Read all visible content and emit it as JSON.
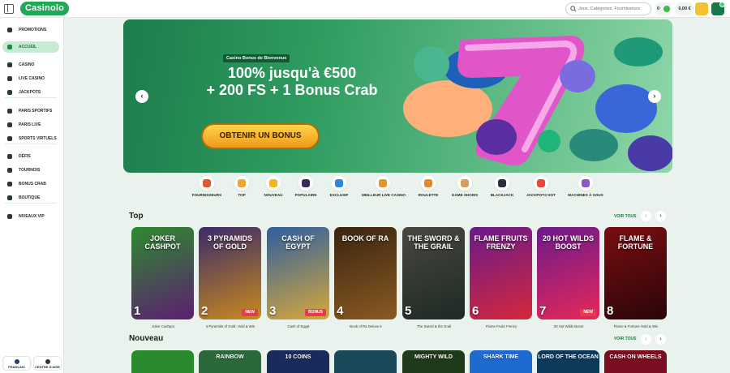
{
  "header": {
    "logo": "Casinolo",
    "search_placeholder": "Jeux, Catégories, Fournisseurs",
    "coins": "0",
    "balance": "0,00 €"
  },
  "sidebar": {
    "items": [
      {
        "label": "PROMOTIONS",
        "icon": "gift-icon"
      },
      {
        "label": "ACCUEIL",
        "icon": "home-icon",
        "active": true
      },
      {
        "label": "CASINO",
        "icon": "casino-chip-icon"
      },
      {
        "label": "LIVE CASINO",
        "icon": "live-casino-icon"
      },
      {
        "label": "JACKPOTS",
        "icon": "jackpot-icon"
      },
      {
        "label": "PARIS SPORTIFS",
        "icon": "football-icon"
      },
      {
        "label": "PARIS LIVE",
        "icon": "live-tv-icon"
      },
      {
        "label": "SPORTS VIRTUELS",
        "icon": "virtual-sports-icon"
      },
      {
        "label": "DÉFIS",
        "icon": "challenge-icon"
      },
      {
        "label": "TOURNOIS",
        "icon": "trophy-icon"
      },
      {
        "label": "BONUS CRAB",
        "icon": "crab-icon"
      },
      {
        "label": "BOUTIQUE",
        "icon": "shop-icon"
      },
      {
        "label": "NIVEAUX VIP",
        "icon": "vip-crown-icon"
      }
    ],
    "language": "FRANÇAIS",
    "help": "CENTRE D'AIDE"
  },
  "hero": {
    "tag": "Casino Bonus de Bienvenue",
    "line1": "100% jusqu'à €500",
    "line2": "+ 200 FS + 1 Bonus Crab",
    "cta": "OBTENIR UN BONUS",
    "prev": "‹",
    "next": "›",
    "slides": 3,
    "active_slide": 1
  },
  "categories": [
    {
      "label": "FOURNISSEURS",
      "color": "#e0592b"
    },
    {
      "label": "TOP",
      "color": "#f0a531"
    },
    {
      "label": "NOUVEAU",
      "color": "#f2b61f"
    },
    {
      "label": "POPULAIRE",
      "color": "#3a2b58"
    },
    {
      "label": "EXCLUSIF",
      "color": "#2f86e0"
    },
    {
      "label": "MEILLEUR LIVE CASINO",
      "color": "#e3962d"
    },
    {
      "label": "ROULETTE",
      "color": "#e58a29"
    },
    {
      "label": "GAME SHOWS",
      "color": "#d4a05a"
    },
    {
      "label": "BLACKJACK",
      "color": "#2b2f3a"
    },
    {
      "label": "JACKPOTS HOT",
      "color": "#e54a3a"
    },
    {
      "label": "MACHINES À SOUS",
      "color": "#8a59c8"
    }
  ],
  "top": {
    "title": "Top",
    "see_all": "VOIR TOUS",
    "prev": "‹",
    "next": "›",
    "games": [
      {
        "rank": "1",
        "art": "JOKER CASHPOT",
        "caption": "Joker Cashpot",
        "bg": "#2d8a2e",
        "bg2": "#5d1e72"
      },
      {
        "rank": "2",
        "art": "3 PYRAMIDS OF GOLD",
        "caption": "3 Pyramids of Gold: Hold & Win",
        "bg": "#3b2a6b",
        "bg2": "#c98a1c",
        "badge": "NEW"
      },
      {
        "rank": "3",
        "art": "CASH OF EGYPT",
        "caption": "Cash of Egypt",
        "bg": "#2d5ea0",
        "bg2": "#d6a83a",
        "badge": "BONUS"
      },
      {
        "rank": "4",
        "art": "BOOK OF RA",
        "caption": "Book of Ra Deluxe 6",
        "bg": "#3a2410",
        "bg2": "#8a5a22"
      },
      {
        "rank": "5",
        "art": "THE SWORD & THE GRAIL",
        "caption": "The Sword & the Grail",
        "bg": "#4a4640",
        "bg2": "#1d2a24"
      },
      {
        "rank": "6",
        "art": "FLAME FRUITS FRENZY",
        "caption": "Flame Fruits Frenzy",
        "bg": "#6a1a8a",
        "bg2": "#d4283c"
      },
      {
        "rank": "7",
        "art": "20 HOT WILDS BOOST",
        "caption": "20 Hot Wilds Boost",
        "bg": "#6a1a8a",
        "bg2": "#e6285a",
        "badge": "NEW"
      },
      {
        "rank": "8",
        "art": "FLAME & FORTUNE",
        "caption": "Flame & Fortune Hold & Win",
        "bg": "#7a0d12",
        "bg2": "#2a0608"
      }
    ]
  },
  "nouveau": {
    "title": "Nouveau",
    "see_all": "VOIR TOUS",
    "prev": "‹",
    "next": "›",
    "games": [
      {
        "art": "",
        "bg": "#2a8a2e"
      },
      {
        "art": "RAINBOW",
        "bg": "#2a6a3a"
      },
      {
        "art": "10 COINS",
        "bg": "#1a2a5a"
      },
      {
        "art": "",
        "bg": "#1a4a5a"
      },
      {
        "art": "MIGHTY WILD",
        "bg": "#1f3a1a"
      },
      {
        "art": "SHARK TIME",
        "bg": "#1f6ad0"
      },
      {
        "art": "LORD OF THE OCEAN",
        "bg": "#0d3a5a"
      },
      {
        "art": "CASH ON WHEELS",
        "bg": "#7a0d20"
      }
    ]
  },
  "colors": {
    "accent": "#1fa855",
    "hero_bg": "#2f9c60",
    "cta": "#f2b01f"
  }
}
